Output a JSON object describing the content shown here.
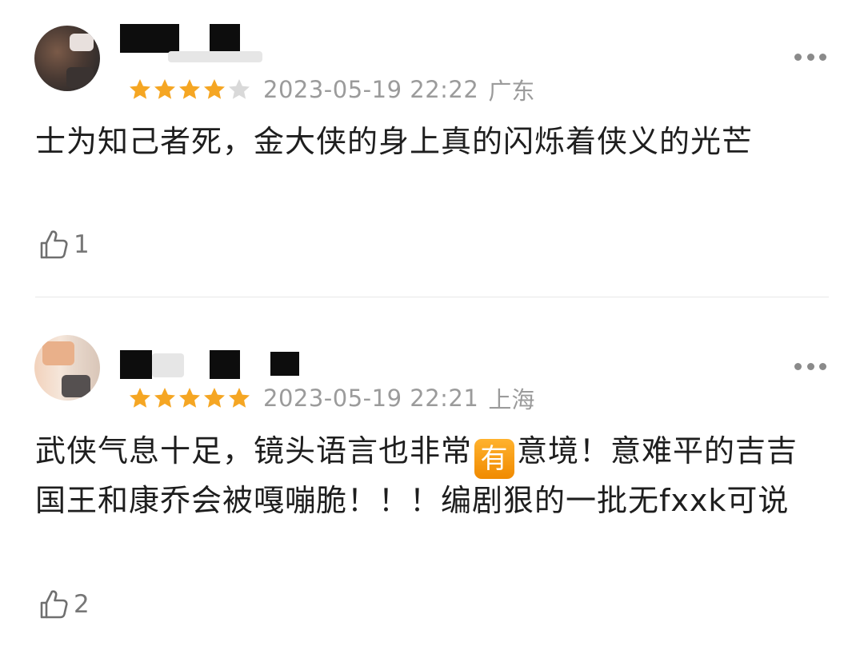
{
  "comments": [
    {
      "rating": 4,
      "date": "2023-05-19 22:22",
      "location": "广东",
      "content": "士为知己者死，金大侠的身上真的闪烁着侠义的光芒",
      "likes": "1"
    },
    {
      "rating": 5,
      "date": "2023-05-19 22:21",
      "location": "上海",
      "content_before": "武侠气息十足，镜头语言也非常",
      "emoji": "有",
      "content_after": "意境！意难平的吉吉国王和康乔会被嘎嘣脆！！！编剧狠的一批无fxxk可说",
      "likes": "2"
    }
  ],
  "colors": {
    "star_filled": "#f5a623",
    "star_empty": "#d9d9d9",
    "meta_text": "#9b9b9b",
    "emoji_bg": "#f39a0e"
  },
  "icons": {
    "more": "more-dots-icon",
    "like": "thumbs-up-icon",
    "star": "star-icon"
  }
}
